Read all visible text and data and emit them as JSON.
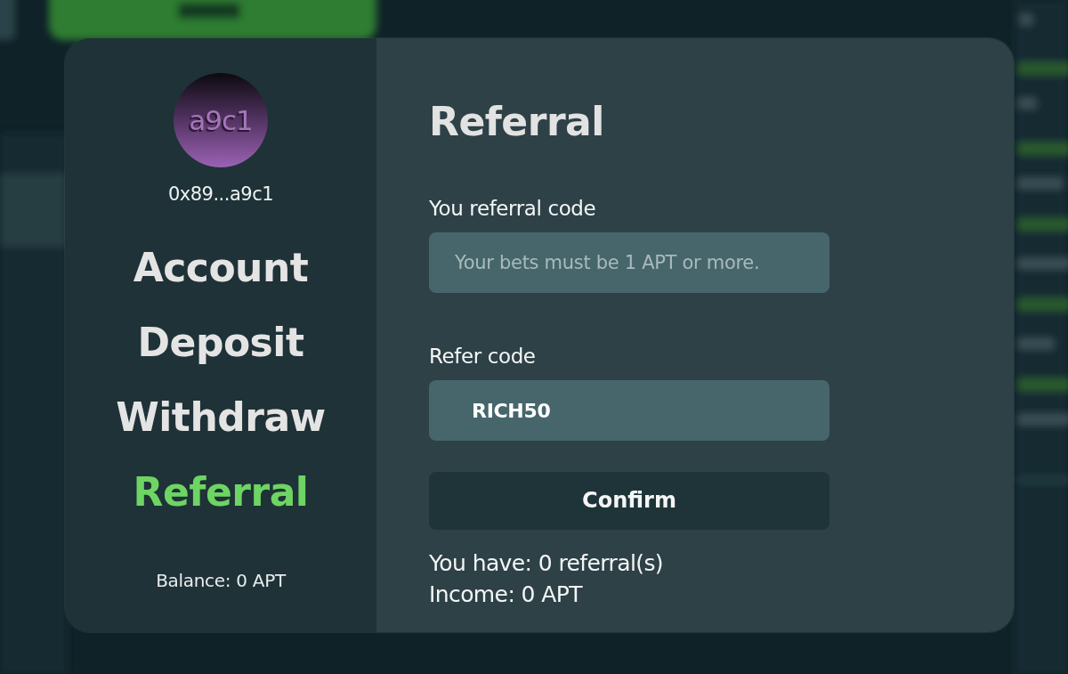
{
  "avatar": {
    "initials": "a9c1"
  },
  "address": "0x89...a9c1",
  "menu": [
    {
      "label": "Account",
      "selected": false
    },
    {
      "label": "Deposit",
      "selected": false
    },
    {
      "label": "Withdraw",
      "selected": false
    },
    {
      "label": "Referral",
      "selected": true
    }
  ],
  "balance": "Balance: 0 APT",
  "panel": {
    "title": "Referral",
    "fields": [
      {
        "label": "You referral code",
        "placeholder": "Your bets must be 1 APT or more."
      },
      {
        "label": "Refer code",
        "value": "RICH50"
      }
    ],
    "confirm_button": "Confirm",
    "stats": [
      "You have: 0 referral(s)",
      "Income: 0 APT"
    ]
  }
}
